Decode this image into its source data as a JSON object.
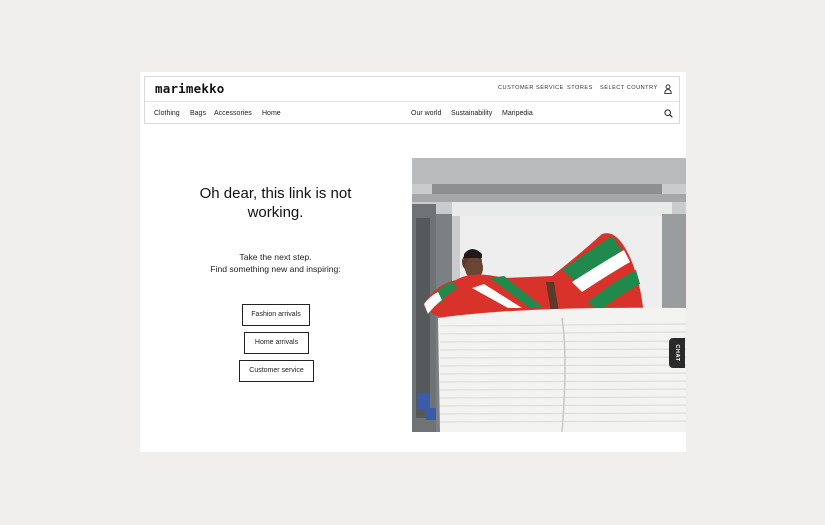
{
  "brand": {
    "logo": "marimekko"
  },
  "utility_nav": {
    "customer_service": "CUSTOMER SERVICE",
    "stores": "STORES",
    "select_country": "SELECT COUNTRY",
    "account_icon": "user-icon"
  },
  "main_nav": {
    "left": [
      "Clothing",
      "Bags",
      "Accessories",
      "Home"
    ],
    "right": [
      "Our world",
      "Sustainability",
      "Maripedia"
    ],
    "search_icon": "search-icon"
  },
  "error": {
    "heading_line1": "Oh dear, this link is not",
    "heading_line2": "working.",
    "sub_line1": "Take the next step.",
    "sub_line2": "Find something new and inspiring:"
  },
  "buttons": {
    "fashion": "Fashion arrivals",
    "home": "Home arrivals",
    "customer_service": "Customer service"
  },
  "chat": {
    "label": "CHAT"
  },
  "colors": {
    "background": "#f0efed",
    "page": "#ffffff",
    "text": "#111111",
    "border": "#222222",
    "chat_tab": "#2a2a2a",
    "stripe_red": "#d9322b",
    "stripe_green": "#1f8a4c"
  }
}
